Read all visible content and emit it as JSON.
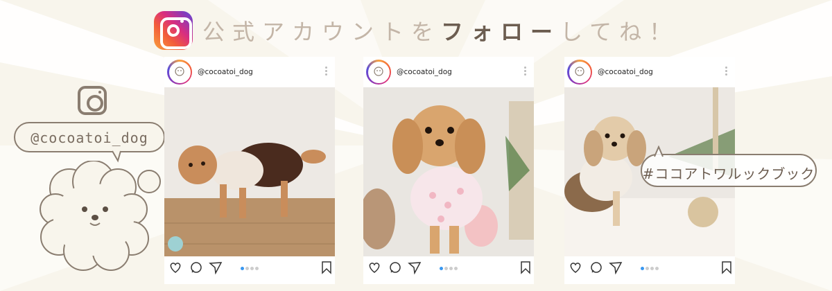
{
  "header": {
    "title_part1": "公式アカウントを",
    "title_part2": "フォロー",
    "title_part3": "してね！",
    "icon": "instagram-icon"
  },
  "side": {
    "icon": "instagram-icon",
    "handle": "@cocoatoi_dog",
    "mascot": "poodle-illustration"
  },
  "posts": [
    {
      "username": "@cocoatoi_dog",
      "photo": "poodle-in-brown-dress",
      "carousel_active": 1,
      "carousel_total": 4
    },
    {
      "username": "@cocoatoi_dog",
      "photo": "dog-in-pink-heart-shirt",
      "carousel_active": 1,
      "carousel_total": 4
    },
    {
      "username": "@cocoatoi_dog",
      "photo": "dog-in-plaid-outfit",
      "carousel_active": 1,
      "carousel_total": 4
    }
  ],
  "hashtag": "#ココアトワルックブック",
  "colors": {
    "background": "#f8f5ec",
    "title_light": "#c3b5a7",
    "title_dark": "#6c5d50",
    "carousel_active": "#3897f0"
  }
}
